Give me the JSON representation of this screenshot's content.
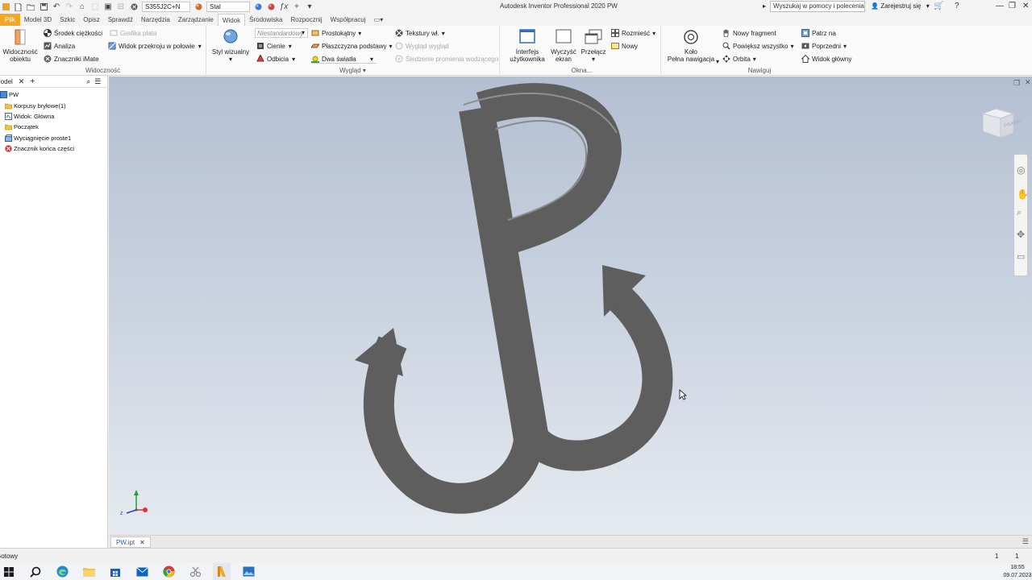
{
  "titlebar": {
    "app_title": "Autodesk Inventor Professional 2020   PW",
    "material_field": "S355J2C+N",
    "appearance_field": "Stal",
    "search": "Wyszukaj w pomocy i poleceniach...",
    "signin": "Zarejestruj się"
  },
  "tabs": [
    "Plik",
    "Model 3D",
    "Szkic",
    "Opisz",
    "Sprawdź",
    "Narzędzia",
    "Zarządzanie",
    "Widok",
    "Środowiska",
    "Rozpocznij",
    "Współpracuj"
  ],
  "ribbon": {
    "visibility": {
      "label": "Widoczność",
      "object_visibility": "Widoczność obiektu",
      "center_of_gravity": "Środek ciężkości",
      "analysis": "Analiza",
      "imate": "Znaczniki iMate",
      "plate_graphics": "Grafika płata",
      "half_section": "Widok przekroju w połowie"
    },
    "appearance": {
      "label": "Wygląd",
      "visual_style": "Styl wizualny",
      "preset": "Niestandardowy",
      "shadows": "Cienie",
      "reflections": "Odbicia",
      "rectangular": "Prostokątny",
      "ground_plane": "Płaszczyzna podstawy",
      "lighting": "Dwa światła",
      "textures": "Tekstury wł.",
      "appearance_view": "Wygląd wygląd",
      "ray_tracing": "Śledzenie promienia wodzącego"
    },
    "windows": {
      "label": "Okna",
      "user_interface": "Interfejs użytkownika",
      "clean_screen": "Wyczyść ekran",
      "switch": "Przełącz",
      "arrange": "Rozmieść",
      "new": "Nowy"
    },
    "navigate": {
      "label": "Nawiguj",
      "wheel": "Koło",
      "full_navigation": "Pełna nawigacja",
      "new_fragment": "Nowy fragment",
      "zoom_all": "Powiększ wszystko",
      "orbit": "Orbita",
      "look_at": "Patrz na",
      "previous": "Poprzedni",
      "home_view": "Widok główny"
    }
  },
  "browser": {
    "tab_label": "Model",
    "tree": [
      "PW",
      "Korpusy bryłowe(1)",
      "Widok: Główna",
      "Początek",
      "Wyciągnięcie proste1",
      "Znacznik końca części"
    ]
  },
  "viewcube_label": "PRAWO",
  "document_tab": "PW.ipt",
  "status": {
    "left": "Gotowy",
    "count_a": "1",
    "count_b": "1"
  },
  "taskbar": {
    "time": "18:55",
    "date": "09.07.2023"
  }
}
